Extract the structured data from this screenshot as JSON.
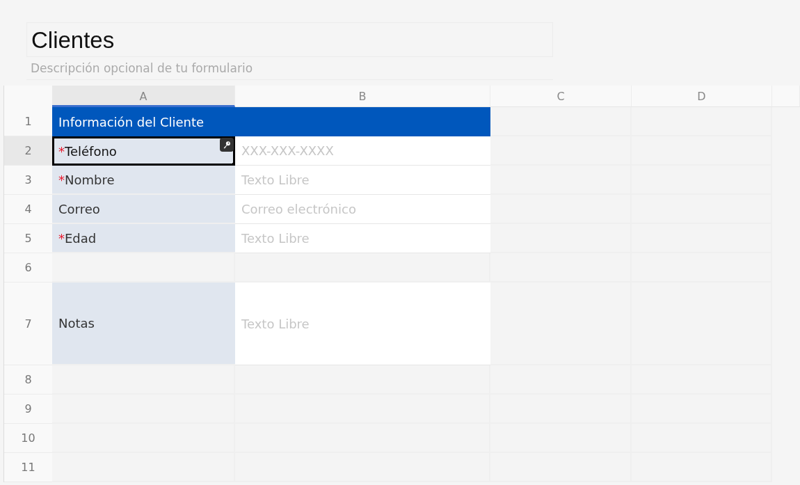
{
  "form": {
    "title": "Clientes",
    "description": "Descripción opcional de tu formulario"
  },
  "columns": [
    {
      "label": "A",
      "selected": true
    },
    {
      "label": "B",
      "selected": false
    },
    {
      "label": "C",
      "selected": false
    },
    {
      "label": "D",
      "selected": false
    }
  ],
  "rows": [
    {
      "number": "1",
      "kind": "section",
      "selected": false,
      "text": "Información del Cliente"
    },
    {
      "number": "2",
      "kind": "field",
      "selected": true,
      "required_mark": "*",
      "label": "Teléfono",
      "placeholder": "XXX-XXX-XXXX",
      "tall": false
    },
    {
      "number": "3",
      "kind": "field",
      "selected": false,
      "required_mark": "*",
      "label": "Nombre",
      "placeholder": "Texto Libre",
      "tall": false
    },
    {
      "number": "4",
      "kind": "field",
      "selected": false,
      "label": "Correo",
      "placeholder": "Correo electrónico",
      "tall": false
    },
    {
      "number": "5",
      "kind": "field",
      "selected": false,
      "required_mark": "*",
      "label": "Edad",
      "placeholder": "Texto Libre",
      "tall": false
    },
    {
      "number": "6",
      "kind": "blank",
      "selected": false
    },
    {
      "number": "7",
      "kind": "field",
      "selected": false,
      "label": "Notas",
      "placeholder": "Texto Libre",
      "tall": true
    },
    {
      "number": "8",
      "kind": "blank",
      "selected": false
    },
    {
      "number": "9",
      "kind": "blank",
      "selected": false
    },
    {
      "number": "10",
      "kind": "blank",
      "selected": false
    },
    {
      "number": "11",
      "kind": "blank",
      "selected": false
    }
  ]
}
